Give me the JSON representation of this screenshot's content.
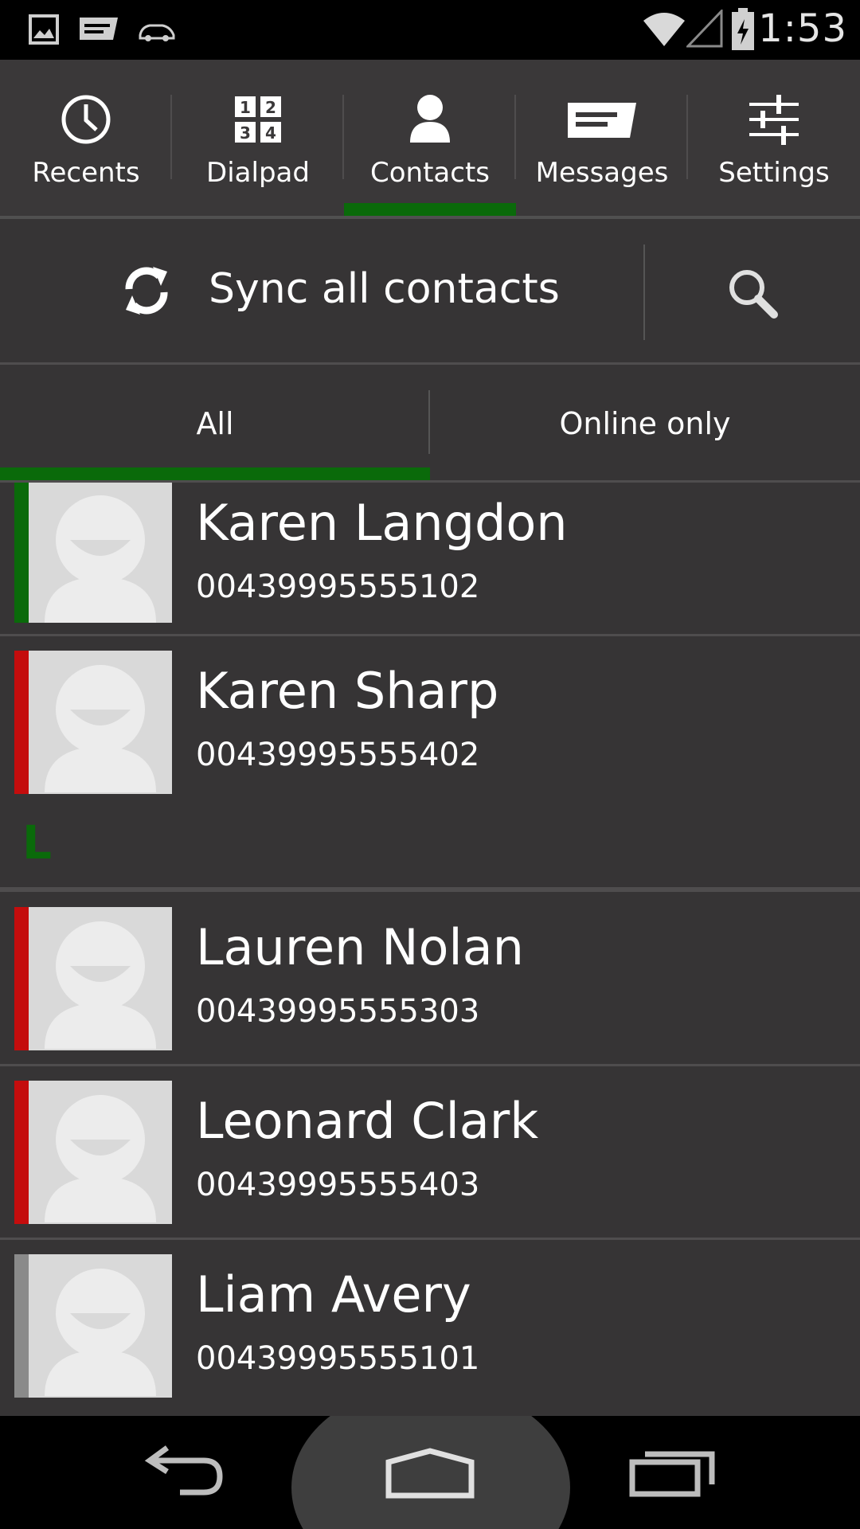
{
  "status_bar": {
    "time": "1:53",
    "icons": [
      "image-icon",
      "message-icon",
      "car-icon",
      "wifi-icon",
      "signal-icon",
      "battery-charging-icon"
    ]
  },
  "top_tabs": [
    {
      "label": "Recents",
      "icon": "clock-icon",
      "active": false
    },
    {
      "label": "Dialpad",
      "icon": "dialpad-icon",
      "active": false
    },
    {
      "label": "Contacts",
      "icon": "person-icon",
      "active": true
    },
    {
      "label": "Messages",
      "icon": "message-icon",
      "active": false
    },
    {
      "label": "Settings",
      "icon": "sliders-icon",
      "active": false
    }
  ],
  "sync": {
    "label": "Sync all contacts",
    "icon": "sync-icon"
  },
  "search": {
    "icon": "search-icon"
  },
  "filters": [
    {
      "label": "All",
      "active": true
    },
    {
      "label": "Online only",
      "active": false
    }
  ],
  "colors": {
    "accent_green": "#0a6a0a",
    "status_online": "#0a6a0a",
    "status_busy": "#c40d0d",
    "status_offline": "#8a8a8a",
    "background": "#363435"
  },
  "contacts": [
    {
      "name": "Karen Langdon",
      "number": "00439995555102",
      "status": "online"
    },
    {
      "name": "Karen Sharp",
      "number": "00439995555402",
      "status": "busy"
    },
    {
      "name": "Lauren Nolan",
      "number": "00439995555303",
      "status": "busy"
    },
    {
      "name": "Leonard Clark",
      "number": "00439995555403",
      "status": "busy"
    },
    {
      "name": "Liam Avery",
      "number": "00439995555101",
      "status": "offline"
    }
  ],
  "section_letter": "L",
  "nav": {
    "back_icon": "back-icon",
    "home_icon": "home-icon",
    "recents_icon": "recent-apps-icon"
  }
}
